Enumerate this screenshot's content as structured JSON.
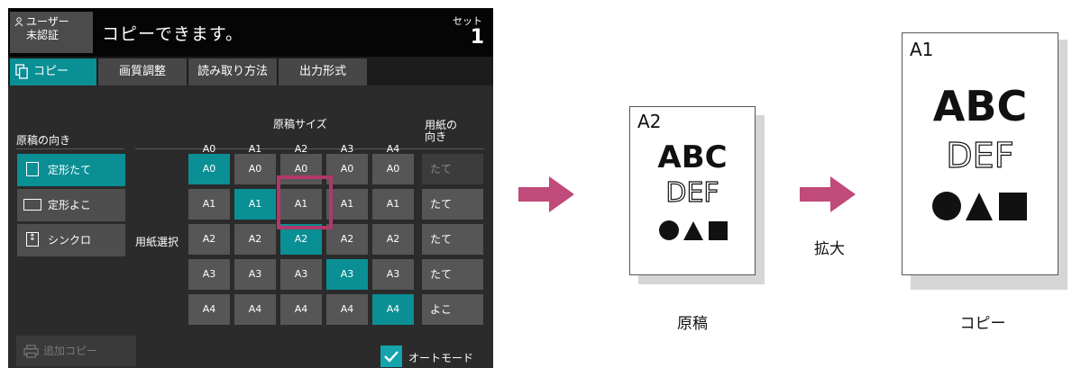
{
  "panel": {
    "user_button": "ユーザー\n未認証",
    "status_message": "コピーできます。",
    "set_label": "セット",
    "set_count": "1",
    "tabs": [
      {
        "label": "コピー",
        "active": true
      },
      {
        "label": "画質調整",
        "active": false
      },
      {
        "label": "読み取り方法",
        "active": false
      },
      {
        "label": "出力形式",
        "active": false
      }
    ],
    "original_orientation_label": "原稿の向き",
    "original_size_label": "原稿サイズ",
    "paper_orientation_label": "用紙の\n向き",
    "paper_select_label": "用紙選択",
    "original_sizes": [
      "A0",
      "A1",
      "A2",
      "A3",
      "A4"
    ],
    "orientation_buttons": [
      {
        "label": "定形たて",
        "active": true,
        "icon": "portrait-page-icon"
      },
      {
        "label": "定形よこ",
        "active": false,
        "icon": "landscape-page-icon"
      },
      {
        "label": "シンクロ",
        "active": false,
        "icon": "sync-arrow-icon"
      }
    ],
    "grid": [
      [
        "A0",
        "A0",
        "A0",
        "A0",
        "A0"
      ],
      [
        "A1",
        "A1",
        "A1",
        "A1",
        "A1"
      ],
      [
        "A2",
        "A2",
        "A2",
        "A2",
        "A2"
      ],
      [
        "A3",
        "A3",
        "A3",
        "A3",
        "A3"
      ],
      [
        "A4",
        "A4",
        "A4",
        "A4",
        "A4"
      ]
    ],
    "paper_orientation": [
      "たて",
      "たて",
      "たて",
      "たて",
      "よこ"
    ],
    "add_copy_button": "追加コピー",
    "auto_mode_label": "オートモード",
    "auto_mode_checked": true
  },
  "illustration": {
    "original": {
      "size": "A2",
      "abc": "ABC",
      "def": "DEF",
      "caption": "原稿"
    },
    "copy": {
      "size": "A1",
      "abc": "ABC",
      "def": "DEF",
      "caption": "コピー"
    },
    "action_label": "拡大"
  },
  "colors": {
    "accent": "#0a8f94",
    "highlight": "#b0386a",
    "arrow": "#c04a7a"
  }
}
